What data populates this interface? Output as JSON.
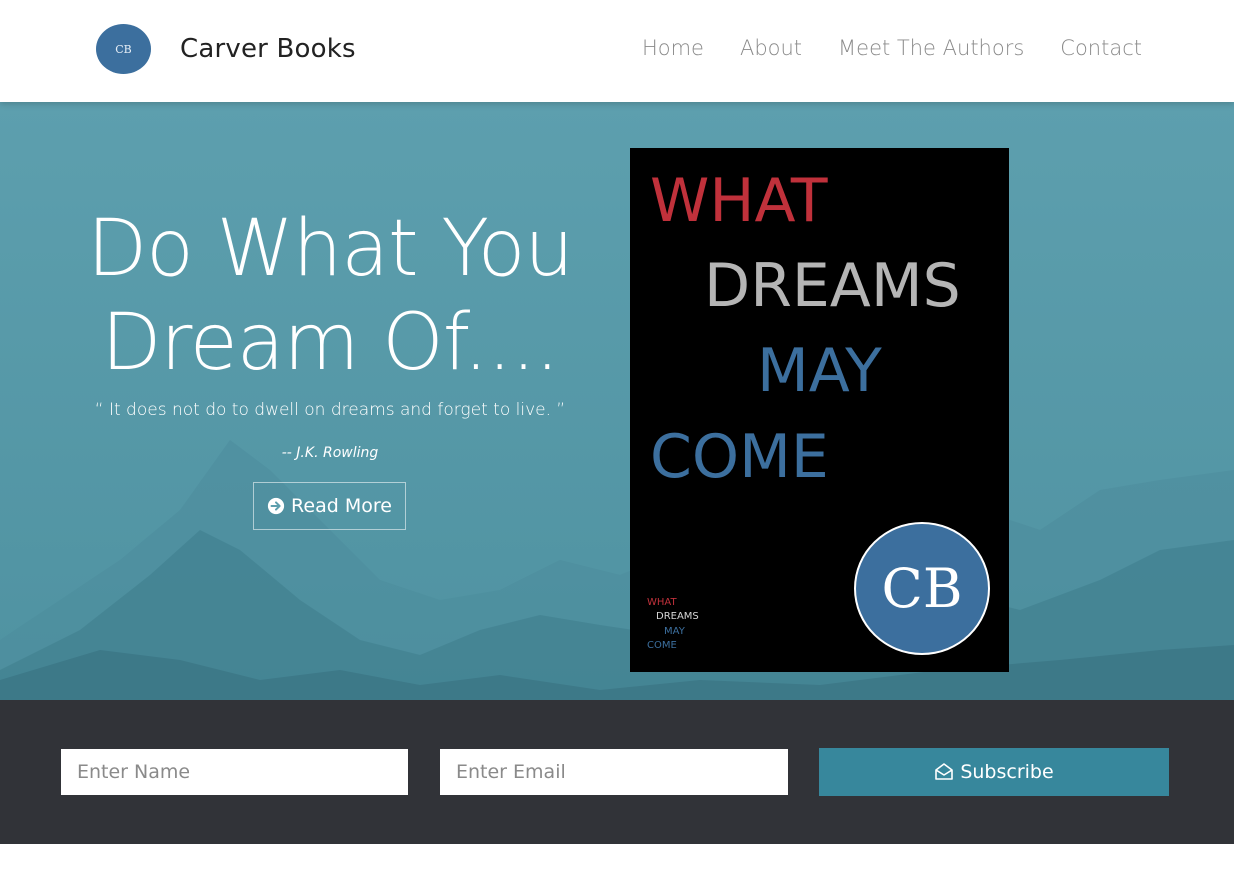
{
  "navbar": {
    "logo_text": "CB",
    "brand": "Carver Books",
    "links": [
      "Home",
      "About",
      "Meet The Authors",
      "Contact"
    ]
  },
  "hero": {
    "title": "Do What You Dream Of....",
    "quote": "“ It does not do to dwell on dreams and forget to live. ”",
    "author": "-- J.K. Rowling",
    "read_more_label": "Read More"
  },
  "book": {
    "words": [
      "WHAT",
      "DREAMS",
      "MAY",
      "COME"
    ],
    "logo_text": "CB"
  },
  "subscribe": {
    "name_placeholder": "Enter Name",
    "email_placeholder": "Enter Email",
    "button_label": "Subscribe"
  },
  "colors": {
    "hero": "#5d9fae",
    "book_red": "#c0313b",
    "book_blue": "#3c6f9e",
    "footer": "#313338",
    "subscribe_button": "#37879c"
  },
  "icons": [
    "arrow-right-icon",
    "envelope-open-icon"
  ]
}
